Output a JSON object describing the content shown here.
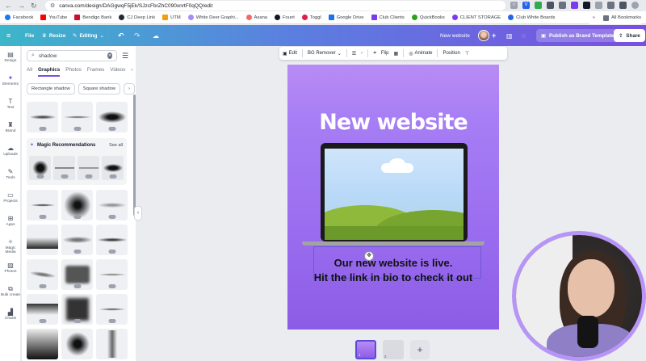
{
  "browser": {
    "url": "canva.com/design/DAGgwqF5jEk/SJzcFbrZhC090xnrtF0qQQ/edit",
    "bookmarks": [
      "Facebook",
      "YouTube",
      "Bendigo Bank",
      "CJ Deep Link",
      "UTM",
      "White Deer Graphi...",
      "Asana",
      "Fount",
      "Toggl",
      "Google Drive",
      "Club Clients",
      "QuickBooks",
      "CLIENT STORAGE",
      "Club White Boards"
    ],
    "all_bookmarks_label": "All Bookmarks",
    "bookmark_colors": [
      "#1877f2",
      "#ff0000",
      "#c8102e",
      "#1f2937",
      "#f59e0b",
      "#6b7280",
      "#f06a6a",
      "#111827",
      "#e11d48",
      "#1a73e8",
      "#7c3aed",
      "#2ca01c",
      "#7c3aed",
      "#2563eb"
    ]
  },
  "header": {
    "file_label": "File",
    "resize_label": "Resize",
    "editing_label": "Editing",
    "design_name": "New website",
    "publish_label": "Publish as Brand Template",
    "share_label": "Share"
  },
  "rail": {
    "items": [
      {
        "label": "Design",
        "icon": "layout-icon"
      },
      {
        "label": "Elements",
        "icon": "elements-icon"
      },
      {
        "label": "Text",
        "icon": "text-icon"
      },
      {
        "label": "Brand",
        "icon": "brand-icon"
      },
      {
        "label": "Uploads",
        "icon": "cloud-upload-icon"
      },
      {
        "label": "Tools",
        "icon": "pen-icon"
      },
      {
        "label": "Projects",
        "icon": "folder-icon"
      },
      {
        "label": "Apps",
        "icon": "apps-grid-icon"
      },
      {
        "label": "Magic Media",
        "icon": "magic-media-icon"
      },
      {
        "label": "Photos",
        "icon": "photo-icon"
      },
      {
        "label": "Bulk create",
        "icon": "bulk-create-icon"
      },
      {
        "label": "Charts",
        "icon": "chart-icon"
      }
    ]
  },
  "panel": {
    "search_value": "shadow",
    "tabs": [
      "All",
      "Graphics",
      "Photos",
      "Frames",
      "Videos"
    ],
    "active_tab": "Graphics",
    "chips": [
      "Rectangle shadow",
      "Square shadow"
    ],
    "magic_title": "Magic Recommendations",
    "see_all": "See all"
  },
  "toolbar": {
    "edit": "Edit",
    "bg_remover": "BG Remover",
    "flip": "Flip",
    "animate": "Animate",
    "position": "Position"
  },
  "design": {
    "title": "New website",
    "line1": "Our new website is live.",
    "line2": "Hit the link in bio to check it out"
  },
  "pages": {
    "active": "1",
    "second": "2",
    "add": "+"
  }
}
